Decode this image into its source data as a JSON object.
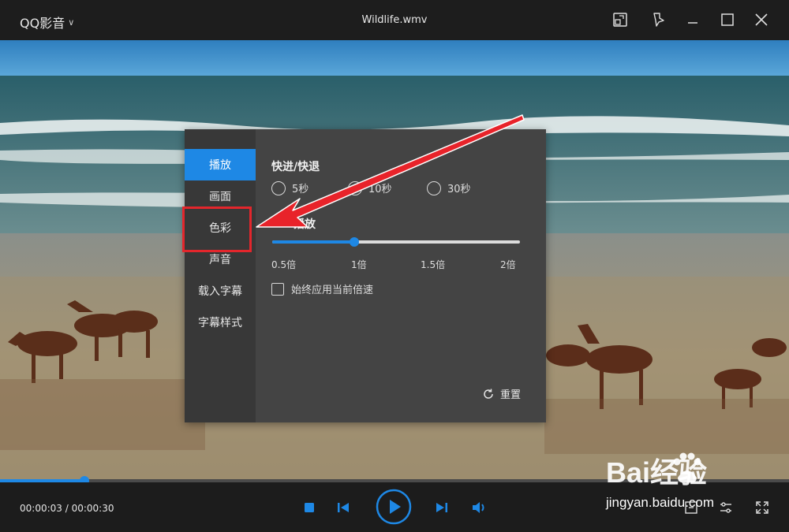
{
  "titlebar": {
    "brand": "QQ影音",
    "file_title": "Wildlife.wmv"
  },
  "settings": {
    "nav": [
      {
        "label": "播放",
        "active": true
      },
      {
        "label": "画面",
        "active": false
      },
      {
        "label": "色彩",
        "active": false
      },
      {
        "label": "声音",
        "active": false
      },
      {
        "label": "载入字幕",
        "active": false
      },
      {
        "label": "字幕样式",
        "active": false
      }
    ],
    "seek_title": "快进/快退",
    "seek_options": [
      "5秒",
      "10秒",
      "30秒"
    ],
    "speed_title": "播放",
    "speed_ticks": [
      "0.5倍",
      "1倍",
      "1.5倍",
      "2倍"
    ],
    "speed_value_fraction": 0.33,
    "always_apply_label": "始终应用当前倍速",
    "reset_label": "重置"
  },
  "player": {
    "time": "00:00:03 / 00:00:30",
    "progress_fraction": 0.107
  },
  "watermark": {
    "logo": "Bai经验",
    "url": "jingyan.baidu.com"
  },
  "colors": {
    "accent": "#1e88e5",
    "highlight": "#e3262c"
  }
}
